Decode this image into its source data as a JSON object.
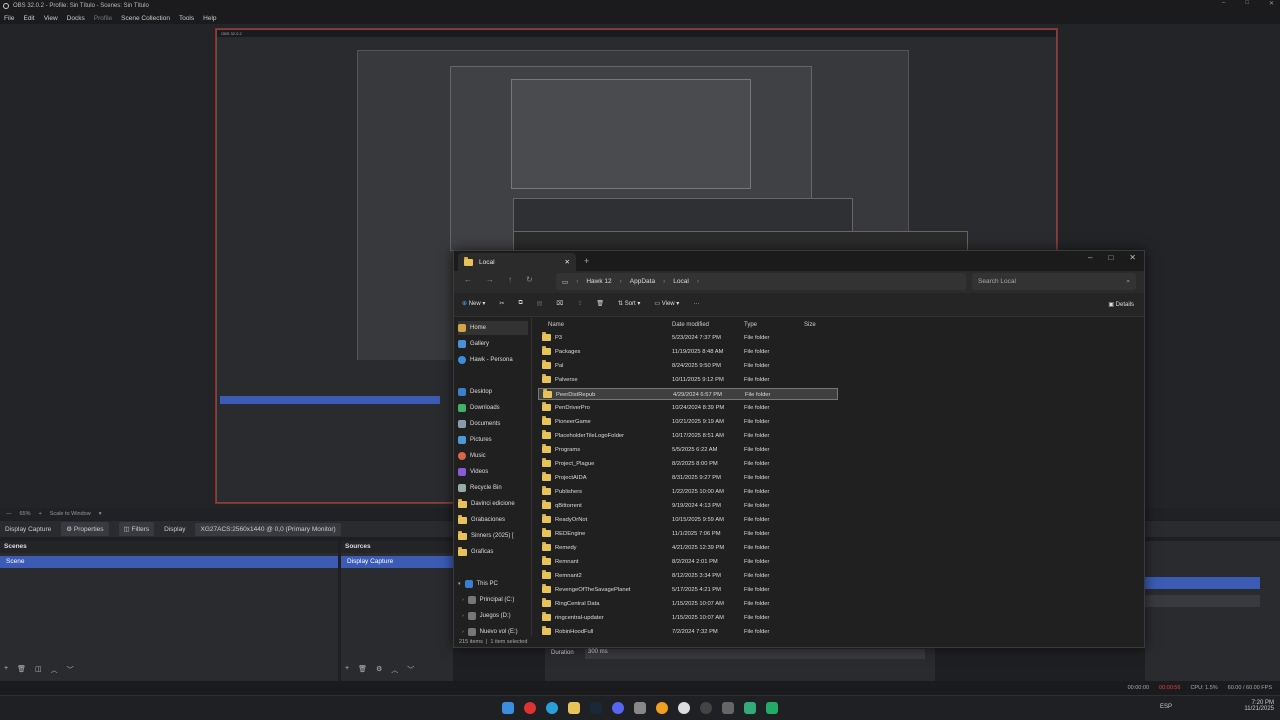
{
  "obs": {
    "title": "OBS 32.0.2 - Profile: Sin Título - Scenes: Sin Título",
    "menu": [
      "File",
      "Edit",
      "View",
      "Docks",
      "Profile",
      "Scene Collection",
      "Tools",
      "Help"
    ],
    "zoom": "65%",
    "scale": "Scale to Window",
    "source_bar": {
      "source": "Display Capture",
      "properties": "Properties",
      "filters": "Filters",
      "display_label": "Display",
      "display_value": "XG27ACS:2560x1440 @ 0,0 (Primary Monitor)"
    },
    "scenes_header": "Scenes",
    "scenes": [
      "Scene"
    ],
    "sources_header": "Sources",
    "sources": [
      "Display Capture"
    ],
    "duration_label": "Duration",
    "duration_value": "300 ms",
    "status": {
      "time1": "00:00:00",
      "time2": "00:00:56",
      "cpu": "CPU: 1.5%",
      "fps": "60.00 / 60.00 FPS"
    }
  },
  "taskbar": {
    "lang": "ESP",
    "time": "7:20 PM",
    "date": "11/21/2025"
  },
  "explorer": {
    "tab_title": "Local",
    "breadcrumb": [
      "Hawk 12",
      "AppData",
      "Local"
    ],
    "search_placeholder": "Search Local",
    "toolbar": {
      "new": "New",
      "sort": "Sort",
      "view": "View",
      "details": "Details"
    },
    "nav": [
      "Home",
      "Gallery",
      "Hawk - Persona",
      "Desktop",
      "Downloads",
      "Documents",
      "Pictures",
      "Music",
      "Videos",
      "Recycle Bin",
      "Davinci edicione",
      "Grabaciones",
      "Sinners (2025) [",
      "Graficas",
      "This PC",
      "Principal (C:)",
      "Juegos (D:)",
      "Nuevo vol (E:)"
    ],
    "columns": [
      "Name",
      "Date modified",
      "Type",
      "Size"
    ],
    "rows": [
      {
        "name": "P3",
        "date": "5/23/2024 7:37 PM",
        "type": "File folder"
      },
      {
        "name": "Packages",
        "date": "11/19/2025 8:48 AM",
        "type": "File folder"
      },
      {
        "name": "Pal",
        "date": "8/24/2025 9:50 PM",
        "type": "File folder"
      },
      {
        "name": "Palverse",
        "date": "10/11/2025 9:12 PM",
        "type": "File folder"
      },
      {
        "name": "PeerDistRepub",
        "date": "4/29/2024 6:57 PM",
        "type": "File folder"
      },
      {
        "name": "PenDriverPro",
        "date": "10/24/2024 8:39 PM",
        "type": "File folder"
      },
      {
        "name": "PioneerGame",
        "date": "10/21/2025 9:19 AM",
        "type": "File folder"
      },
      {
        "name": "PlaceholderTileLogoFolder",
        "date": "10/17/2025 8:51 AM",
        "type": "File folder"
      },
      {
        "name": "Programs",
        "date": "5/5/2025 6:22 AM",
        "type": "File folder"
      },
      {
        "name": "Project_Plague",
        "date": "8/2/2025 8:00 PM",
        "type": "File folder"
      },
      {
        "name": "ProjectAIDA",
        "date": "8/31/2025 9:27 PM",
        "type": "File folder"
      },
      {
        "name": "Publishers",
        "date": "1/22/2025 10:00 AM",
        "type": "File folder"
      },
      {
        "name": "qBittorrent",
        "date": "9/19/2024 4:13 PM",
        "type": "File folder"
      },
      {
        "name": "ReadyOrNot",
        "date": "10/15/2025 9:59 AM",
        "type": "File folder"
      },
      {
        "name": "REDEngine",
        "date": "11/1/2025 7:06 PM",
        "type": "File folder"
      },
      {
        "name": "Remedy",
        "date": "4/21/2025 12:39 PM",
        "type": "File folder"
      },
      {
        "name": "Remnant",
        "date": "8/2/2024 2:01 PM",
        "type": "File folder"
      },
      {
        "name": "Remnant2",
        "date": "8/12/2025 3:34 PM",
        "type": "File folder"
      },
      {
        "name": "RevengeOfTheSavagePlanet",
        "date": "5/17/2025 4:21 PM",
        "type": "File folder"
      },
      {
        "name": "RingCentral Data",
        "date": "1/15/2025 10:07 AM",
        "type": "File folder"
      },
      {
        "name": "ringcentral-updater",
        "date": "1/15/2025 10:07 AM",
        "type": "File folder"
      },
      {
        "name": "RobinHoodFull",
        "date": "7/2/2024 7:32 PM",
        "type": "File folder"
      }
    ],
    "status_items": "215 items",
    "status_selected": "1 item selected"
  }
}
